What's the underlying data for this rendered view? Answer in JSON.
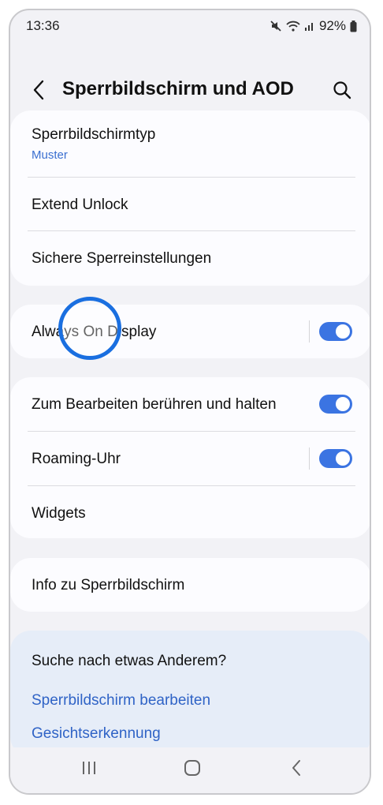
{
  "status_bar": {
    "time": "13:36",
    "battery": "92%",
    "icons": [
      "mute-icon",
      "wifi-icon",
      "signal-icon",
      "battery-icon"
    ]
  },
  "header": {
    "title": "Sperrbildschirm und AOD",
    "back_icon": "chevron-left-icon",
    "search_icon": "search-icon"
  },
  "group1": {
    "items": [
      {
        "label": "Sperrbildschirmtyp",
        "sub": "Muster"
      },
      {
        "label": "Extend Unlock"
      },
      {
        "label": "Sichere Sperreinstellungen"
      }
    ]
  },
  "group2": {
    "items": [
      {
        "label": "Always On Display",
        "toggle": true
      }
    ]
  },
  "group3": {
    "items": [
      {
        "label": "Zum Bearbeiten berühren und halten",
        "toggle": true
      },
      {
        "label": "Roaming-Uhr",
        "toggle": true
      },
      {
        "label": "Widgets"
      }
    ]
  },
  "group4": {
    "items": [
      {
        "label": "Info zu Sperrbildschirm"
      }
    ]
  },
  "suggestions": {
    "title": "Suche nach etwas Anderem?",
    "links": [
      "Sperrbildschirm bearbeiten",
      "Gesichtserkennung"
    ]
  },
  "colors": {
    "accent": "#3b74e2",
    "link": "#2f63c6",
    "background": "#f2f2f6",
    "card": "#fcfcff",
    "suggest_bg": "#e6edf8",
    "touch_ring": "#1a6fe0"
  },
  "nav_bar": {
    "icons": [
      "recent-apps-icon",
      "home-icon",
      "back-icon"
    ]
  }
}
